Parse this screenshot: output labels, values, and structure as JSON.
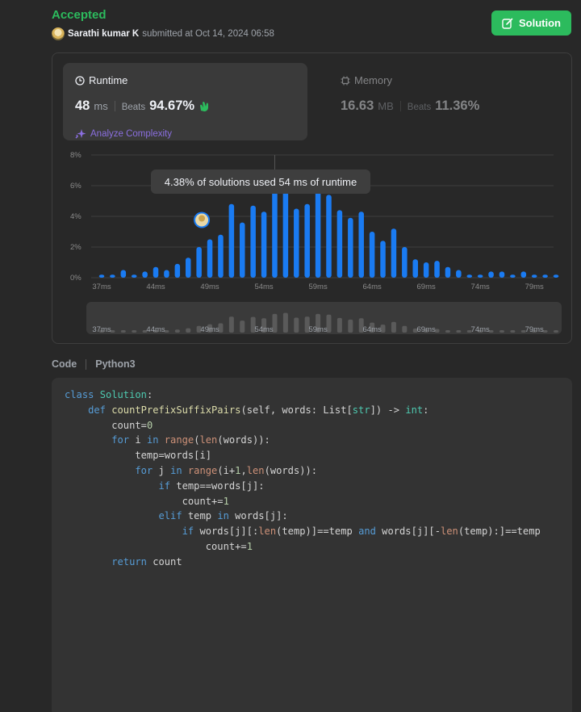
{
  "submission": {
    "status": "Accepted",
    "user": "Sarathi kumar K",
    "submitted_text": "submitted at Oct 14, 2024 06:58",
    "solution_label": "Solution"
  },
  "runtime": {
    "title": "Runtime",
    "value": "48",
    "unit": "ms",
    "beats_label": "Beats",
    "beats_value": "94.67%",
    "analyze_label": "Analyze Complexity"
  },
  "memory": {
    "title": "Memory",
    "value": "16.63",
    "unit": "MB",
    "beats_label": "Beats",
    "beats_value": "11.36%"
  },
  "tooltip": "4.38% of solutions used 54 ms of runtime",
  "chart_data": {
    "type": "bar",
    "y_ticks": [
      "8%",
      "6%",
      "4%",
      "2%",
      "0%"
    ],
    "ylim": [
      0,
      8
    ],
    "x_ticks": [
      "37ms",
      "44ms",
      "49ms",
      "54ms",
      "59ms",
      "64ms",
      "69ms",
      "74ms",
      "79ms"
    ],
    "values": [
      0.2,
      0.2,
      0.5,
      0.2,
      0.4,
      0.7,
      0.5,
      0.9,
      1.3,
      2.0,
      2.5,
      2.8,
      4.8,
      3.6,
      4.7,
      4.3,
      5.6,
      5.9,
      4.5,
      4.8,
      5.6,
      5.4,
      4.4,
      3.9,
      4.3,
      3.0,
      2.4,
      3.2,
      2.0,
      1.2,
      1.0,
      1.1,
      0.7,
      0.5,
      0.2,
      0.2,
      0.4,
      0.4,
      0.2,
      0.4,
      0.2,
      0.2,
      0.2
    ],
    "highlight_index": 10,
    "hover_index": 16,
    "bar_color": "#1a7bf2",
    "mini_bar_color": "#5a5a5a"
  },
  "code": {
    "label": "Code",
    "language": "Python3"
  }
}
